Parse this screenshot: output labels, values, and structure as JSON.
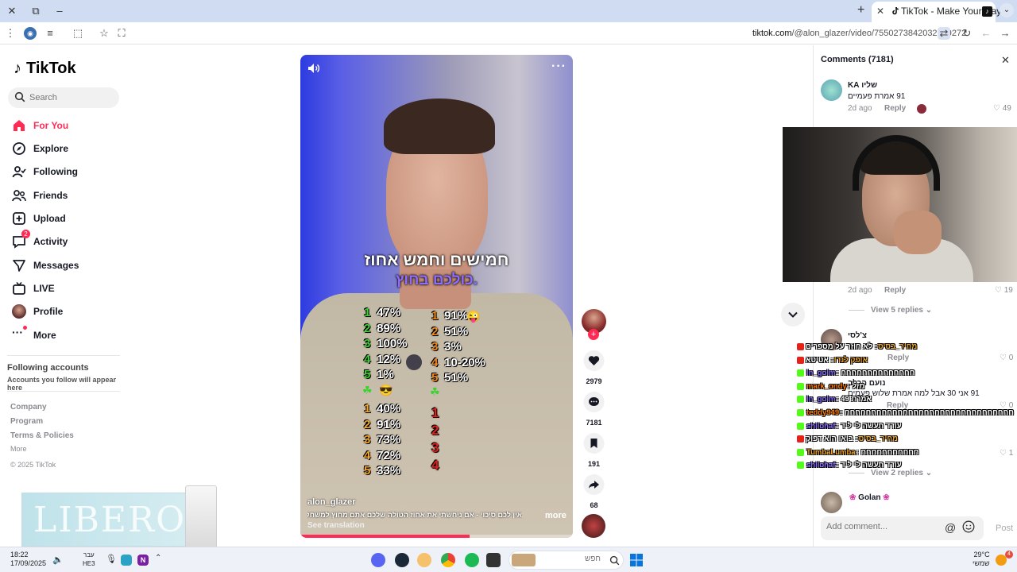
{
  "browser": {
    "tab_title": "TikTok - Make Your Day",
    "url_host": "tiktok.com",
    "url_path": "/@alon_glazer/video/7550273842032299272"
  },
  "sidebar": {
    "logo": "TikTok",
    "search_placeholder": "Search",
    "nav": [
      {
        "label": "For You",
        "icon": "home-icon"
      },
      {
        "label": "Explore",
        "icon": "compass-icon"
      },
      {
        "label": "Following",
        "icon": "user-follow-icon"
      },
      {
        "label": "Friends",
        "icon": "friends-icon"
      },
      {
        "label": "Upload",
        "icon": "upload-icon"
      },
      {
        "label": "Activity",
        "icon": "activity-icon",
        "badge": "2"
      },
      {
        "label": "Messages",
        "icon": "messages-icon"
      },
      {
        "label": "LIVE",
        "icon": "live-icon"
      },
      {
        "label": "Profile",
        "icon": "profile-avatar"
      },
      {
        "label": "More",
        "icon": "more-icon"
      }
    ],
    "following_heading": "Following accounts",
    "following_sub": "Accounts you follow will appear here",
    "footer_links": [
      "Company",
      "Program",
      "Terms & Policies"
    ],
    "footer_more": "More",
    "copyright": "© 2025 TikTok",
    "ad_text": "LIBERO"
  },
  "video": {
    "caption_line1": "חמישים וחמש אחוז",
    "caption_line2": "כולכם בחוץ.",
    "col_left": [
      {
        "n": "1",
        "v": "47%",
        "color": "#3bd12f"
      },
      {
        "n": "2",
        "v": "89%",
        "color": "#3bd12f"
      },
      {
        "n": "3",
        "v": "100%",
        "color": "#3bd12f"
      },
      {
        "n": "4",
        "v": "12%",
        "color": "#3bd12f"
      },
      {
        "n": "5",
        "v": "1%",
        "color": "#3bd12f"
      }
    ],
    "col_right": [
      {
        "n": "1",
        "v": "91%",
        "color": "#f08a1d"
      },
      {
        "n": "2",
        "v": "51%",
        "color": "#f08a1d"
      },
      {
        "n": "3",
        "v": "3%",
        "color": "#f08a1d"
      },
      {
        "n": "4",
        "v": "10-20%",
        "color": "#f08a1d"
      },
      {
        "n": "5",
        "v": "51%",
        "color": "#f08a1d"
      }
    ],
    "col_left2": [
      {
        "n": "1",
        "v": "40%",
        "color": "#f5a623"
      },
      {
        "n": "2",
        "v": "91%",
        "color": "#f5a623"
      },
      {
        "n": "3",
        "v": "73%",
        "color": "#f5a623"
      },
      {
        "n": "4",
        "v": "72%",
        "color": "#f5a623"
      },
      {
        "n": "5",
        "v": "33%",
        "color": "#f5a623"
      }
    ],
    "col_right2": [
      "1",
      "2",
      "3",
      "4"
    ],
    "author": "alon_glazer",
    "description": "אין לכם סיכוי - אם ניחשתי את אחוז הטולה שלכם אתם מחוץ למשחק! ...",
    "see_translation": "See translation",
    "more": "more",
    "progress": 0.62
  },
  "actions": {
    "likes": "2979",
    "comments": "7181",
    "saves": "191",
    "shares": "68"
  },
  "comments": {
    "title": "Comments (7181)",
    "items": [
      {
        "name": "שליו KA",
        "text": "91 אמרת פעמיים",
        "age": "2d ago",
        "reply": "Reply",
        "likes": "49"
      },
      {
        "name": "",
        "text": "",
        "age": "2d ago",
        "reply": "Reply",
        "likes": "19",
        "view_replies": "View 5 replies"
      },
      {
        "name": "צ'לסי",
        "text": "",
        "age": "",
        "reply": "Reply",
        "likes": "0"
      },
      {
        "name": "נועם הכלב",
        "text": "91 אני 30 אבל למה אמרת שלוש פעמים",
        "age": "",
        "reply": "Reply",
        "likes": "0"
      },
      {
        "name": "",
        "text": "",
        "age": "",
        "reply": "",
        "likes": "1",
        "view_replies": "View 2 replies"
      },
      {
        "name": "Golan",
        "text": "",
        "age": "",
        "reply": "",
        "likes": ""
      }
    ],
    "input_placeholder": "Add comment...",
    "post": "Post"
  },
  "chat": [
    {
      "plat": "#e62117",
      "user": "מחיר_בסיס",
      "ucolor": "#f5a623",
      "msg": ": לא חוזר על מספרים"
    },
    {
      "plat": "#e62117",
      "user": "אופק לנדו",
      "ucolor": "#f5a623",
      "msg": ": אטיטא"
    },
    {
      "plat": "#53fc18",
      "user": "ln_golm",
      "ucolor": "#8a6cff",
      "msg": ": חחחחחחחחחחחחחח"
    },
    {
      "plat": "#53fc18",
      "user": "mark_ondy",
      "ucolor": "#ff7a00",
      "msg": ": מזל"
    },
    {
      "plat": "#53fc18",
      "user": "ln_golm",
      "ucolor": "#8a6cff",
      "msg": ": 49 אמרת"
    },
    {
      "plat": "#53fc18",
      "user": "teddy949",
      "ucolor": "#ff7a00",
      "msg": ": חחחחחחחחחחחחחחחחחחחחחחחחחחחחחחחח"
    },
    {
      "plat": "#53fc18",
      "user": "shilohaf",
      "ucolor": "#8a6cff",
      "msg": ": עודד תעשה לי ליד"
    },
    {
      "plat": "#e62117",
      "user": "מחיר_בסיס",
      "ucolor": "#f5a623",
      "msg": ": בואו הוא דפוק"
    },
    {
      "plat": "#53fc18",
      "user": "TumbaLumba",
      "ucolor": "#f5a623",
      "msg": ": חחחחחחחחחחח"
    },
    {
      "plat": "#53fc18",
      "user": "shilohaf",
      "ucolor": "#8a6cff",
      "msg": ": עודד תעשה לי ליד"
    }
  ],
  "taskbar": {
    "time": "18:22",
    "date": "17/09/2025",
    "lang_top": "עבר",
    "lang_bottom": "HE3",
    "search_placeholder": "חפש",
    "temp": "29°C",
    "weather_label": "שמשי",
    "notif_badge": "4"
  }
}
